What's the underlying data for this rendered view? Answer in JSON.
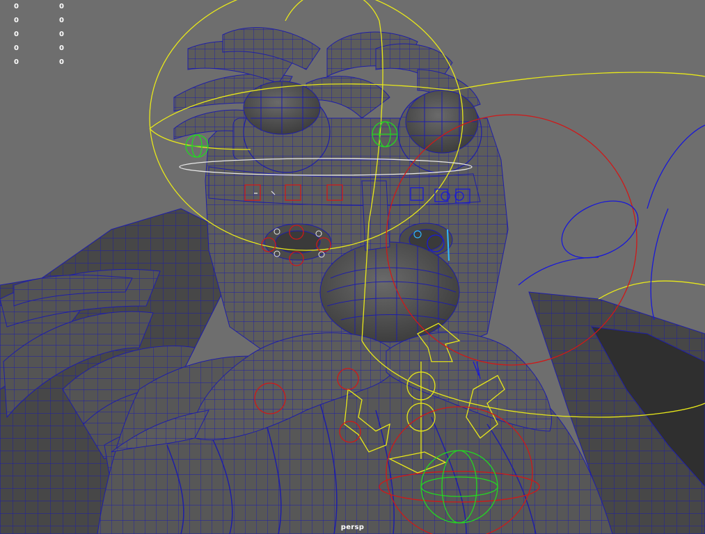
{
  "viewport": {
    "camera_name": "persp",
    "background": "#6e6e6e"
  },
  "hud": {
    "rows": [
      {
        "a": "0",
        "b": "0"
      },
      {
        "a": "0",
        "b": "0"
      },
      {
        "a": "0",
        "b": "0"
      },
      {
        "a": "0",
        "b": "0"
      },
      {
        "a": "0",
        "b": "0"
      }
    ]
  },
  "colors": {
    "wireframe": "#1e1ea8",
    "mesh_fill": "#5c5c5c",
    "mesh_shadow": "#3c3c3c",
    "control_yellow": "#e8e81a",
    "control_red": "#d01818",
    "control_green": "#22d822",
    "control_blue": "#1818d8",
    "control_white": "#e8e8e8",
    "control_cyan": "#30b8ff"
  }
}
